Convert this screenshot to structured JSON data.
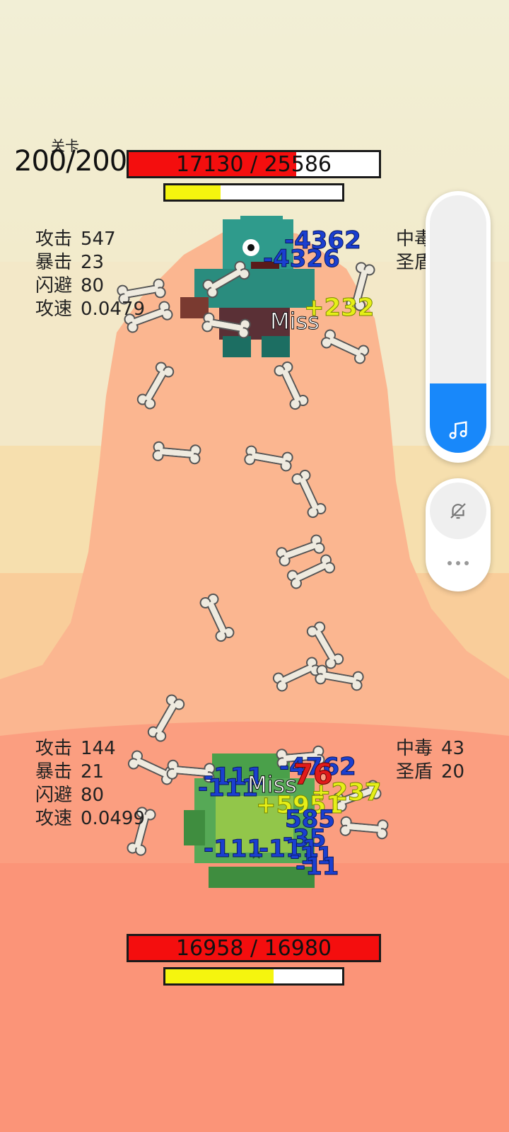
{
  "level": {
    "caption": "关卡",
    "value": "200/200"
  },
  "enemy": {
    "hp_text": "17130 / 25586",
    "hp_fraction": 0.67,
    "energy_fraction": 0.31,
    "stats": [
      {
        "label": "攻击",
        "value": "547"
      },
      {
        "label": "暴击",
        "value": "23"
      },
      {
        "label": "闪避",
        "value": "80"
      },
      {
        "label": "攻速",
        "value": "0.0479"
      }
    ],
    "effects": [
      {
        "label": "中毒",
        "value": ""
      },
      {
        "label": "圣盾",
        "value": ""
      }
    ]
  },
  "player": {
    "hp_text": "16958 / 16980",
    "hp_fraction": 0.999,
    "energy_fraction": 0.61,
    "stats": [
      {
        "label": "攻击",
        "value": "144"
      },
      {
        "label": "暴击",
        "value": "21"
      },
      {
        "label": "闪避",
        "value": "80"
      },
      {
        "label": "攻速",
        "value": "0.0499"
      }
    ],
    "effects": [
      {
        "label": "中毒",
        "value": "43"
      },
      {
        "label": "圣盾",
        "value": "20"
      }
    ]
  },
  "floating_numbers": {
    "enemy": [
      "-4362",
      "-4326",
      "+232",
      "Miss"
    ],
    "player": [
      "-111",
      "-111",
      "Miss",
      "-4762",
      "76",
      "+237",
      "+5951",
      "585",
      "-35",
      "-111",
      "-111",
      "-11",
      "-11"
    ]
  },
  "side_panel": {
    "volume_fraction": 0.27,
    "music_icon": "music-note-icon",
    "mute_icon": "bell-off-icon",
    "more_icon": "more-dots-icon"
  },
  "colors": {
    "hp": "#f40e0e",
    "energy": "#f5f50e",
    "accent": "#1888fa",
    "damage": "#1a3fd0",
    "heal": "#e6ef18"
  }
}
